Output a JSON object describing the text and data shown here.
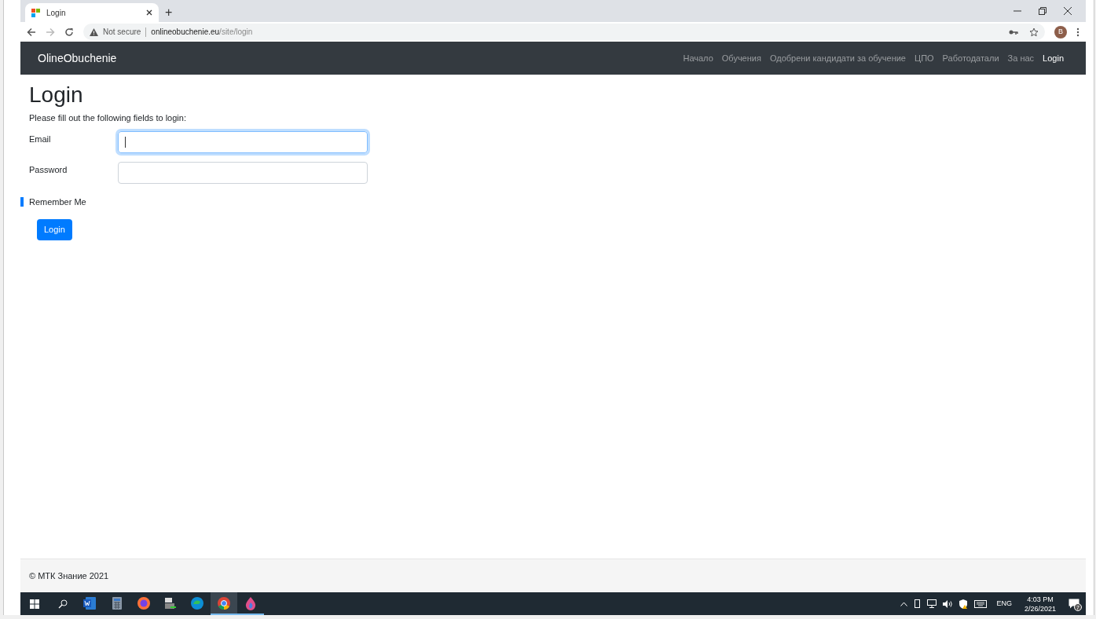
{
  "browser": {
    "tab_title": "Login",
    "new_tab": "+",
    "security": "Not secure",
    "url_host": "onlineobuchenie.eu",
    "url_path": "/site/login",
    "profile": "B"
  },
  "navbar": {
    "brand": "OlineObuchenie",
    "items": [
      {
        "label": "Начало",
        "selected": false
      },
      {
        "label": "Обучения",
        "selected": false
      },
      {
        "label": "Одобрени кандидати за обучение",
        "selected": false
      },
      {
        "label": "ЦПО",
        "selected": false
      },
      {
        "label": "Работодатали",
        "selected": false
      },
      {
        "label": "За нас",
        "selected": false
      },
      {
        "label": "Login",
        "selected": true
      }
    ]
  },
  "form": {
    "heading": "Login",
    "intro": "Please fill out the following fields to login:",
    "fields": [
      {
        "label": "Email",
        "focused": true
      },
      {
        "label": "Password",
        "focused": false
      }
    ],
    "remember": "Remember Me",
    "submit": "Login"
  },
  "footer": {
    "text": "© МТК Знание 2021"
  },
  "taskbar": {
    "apps": [
      {
        "kind": "word",
        "selected": false,
        "running": false
      },
      {
        "kind": "calculator",
        "selected": false,
        "running": false
      },
      {
        "kind": "firefox",
        "selected": false,
        "running": false
      },
      {
        "kind": "files",
        "selected": false,
        "running": false
      },
      {
        "kind": "edge",
        "selected": false,
        "running": false
      },
      {
        "kind": "chrome",
        "selected": true,
        "running": true
      },
      {
        "kind": "drop",
        "selected": false,
        "running": true
      }
    ],
    "language": "ENG",
    "time": "4:03 PM",
    "date": "2/26/2021",
    "notifications": "7"
  }
}
